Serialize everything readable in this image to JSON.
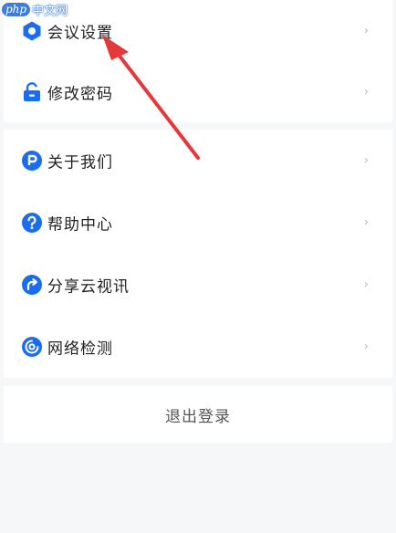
{
  "watermark": {
    "badge": "php",
    "text": "中文网"
  },
  "menu": {
    "items": [
      {
        "label": "会议设置",
        "icon": "hexagon-settings-icon",
        "chevron": "›"
      },
      {
        "label": "修改密码",
        "icon": "lock-icon",
        "chevron": "›"
      },
      {
        "label": "关于我们",
        "icon": "p-circle-icon",
        "chevron": "›"
      },
      {
        "label": "帮助中心",
        "icon": "question-circle-icon",
        "chevron": "›"
      },
      {
        "label": "分享云视讯",
        "icon": "share-circle-icon",
        "chevron": "›"
      },
      {
        "label": "网络检测",
        "icon": "network-check-icon",
        "chevron": "›"
      }
    ]
  },
  "logout": {
    "label": "退出登录"
  },
  "colors": {
    "accent": "#1a6cf0",
    "annotation_arrow": "#e5383b",
    "background": "#f6f7f9"
  }
}
